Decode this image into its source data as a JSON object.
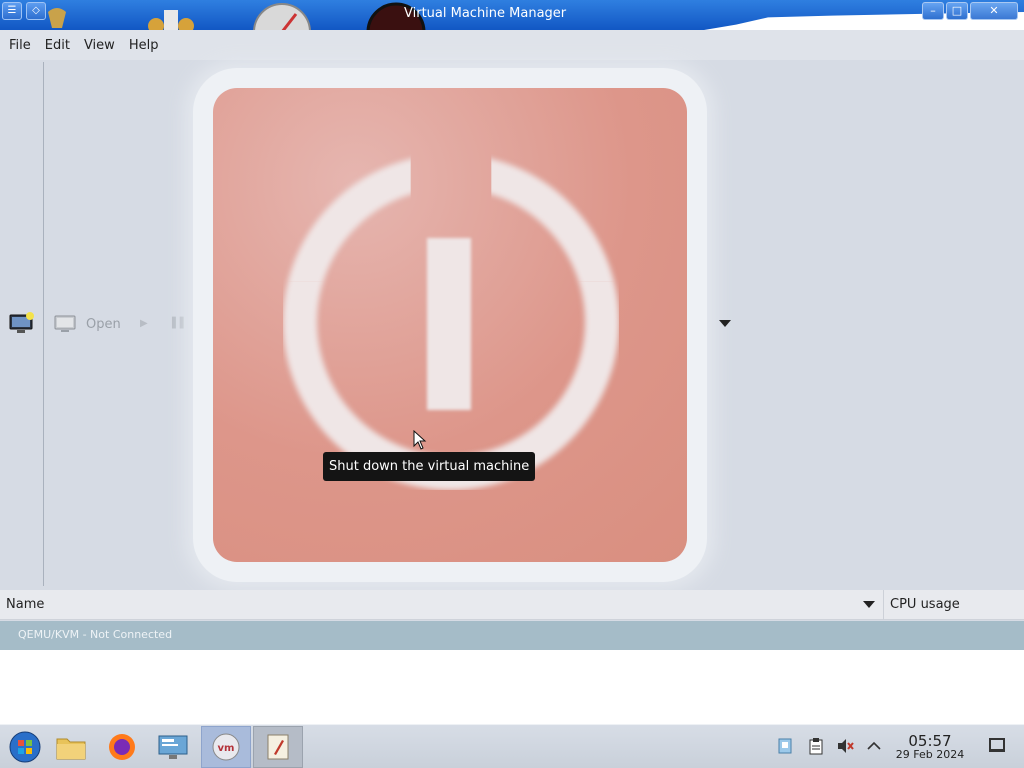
{
  "window": {
    "title": "Virtual Machine Manager",
    "controls": {
      "minimize": "–",
      "maximize": "□",
      "close": "✕"
    }
  },
  "menu": {
    "file": "File",
    "edit": "Edit",
    "view": "View",
    "help": "Help"
  },
  "toolbar": {
    "open_label": "Open",
    "play_glyph": "▶",
    "pause_glyph": "▐▐"
  },
  "tooltip": {
    "text": "Shut down the virtual machine"
  },
  "list": {
    "columns": [
      "Name",
      "CPU usage"
    ],
    "connection": "QEMU/KVM - Not Connected"
  },
  "taskbar": {
    "clock_time": "05:57",
    "clock_date": "29 Feb 2024"
  },
  "colors": {
    "titlebar": "#1f6fd8",
    "shutdown_button": "#dd968a",
    "connection_row": "#a5bcc8",
    "tooltip_bg": "#141414"
  },
  "icons": [
    "new-vm-icon",
    "monitor-icon",
    "play-icon",
    "pause-icon",
    "power-icon",
    "chevron-down-icon",
    "start-orb-icon",
    "file-manager-icon",
    "firefox-icon",
    "remote-desktop-icon",
    "virt-manager-icon",
    "text-editor-icon",
    "network-icon",
    "clipboard-icon",
    "volume-muted-icon",
    "chevron-up-icon",
    "show-desktop-icon"
  ]
}
